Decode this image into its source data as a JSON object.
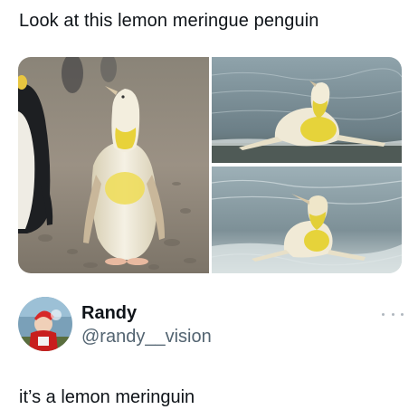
{
  "post": {
    "text": "Look at this lemon meringue penguin"
  },
  "reply": {
    "display_name": "Randy",
    "handle": "@randy__vision",
    "text": "it’s a lemon meringuin"
  },
  "colors": {
    "text_primary": "#0f1419",
    "text_secondary": "#536471",
    "penguin_yellow": "#e8d23a",
    "water": "#7b8f98"
  }
}
